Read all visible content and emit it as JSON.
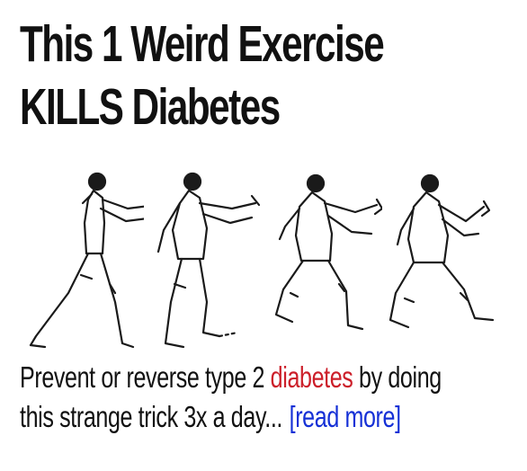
{
  "headline": {
    "line1": "This 1 Weird Exercise",
    "line2": "KILLS Diabetes"
  },
  "teaser": {
    "line1_before": "Prevent or reverse type 2 ",
    "keyword": "diabetes",
    "line1_after": " by doing",
    "line2": "this strange trick 3x a day...",
    "read_more": "[read more]"
  },
  "colors": {
    "headline_text": "#111111",
    "keyword": "#cc1f2a",
    "link": "#1530d6",
    "background": "#ffffff"
  },
  "illustration": {
    "icon": "tai-chi-figures-illustration",
    "figure_count": 4
  }
}
